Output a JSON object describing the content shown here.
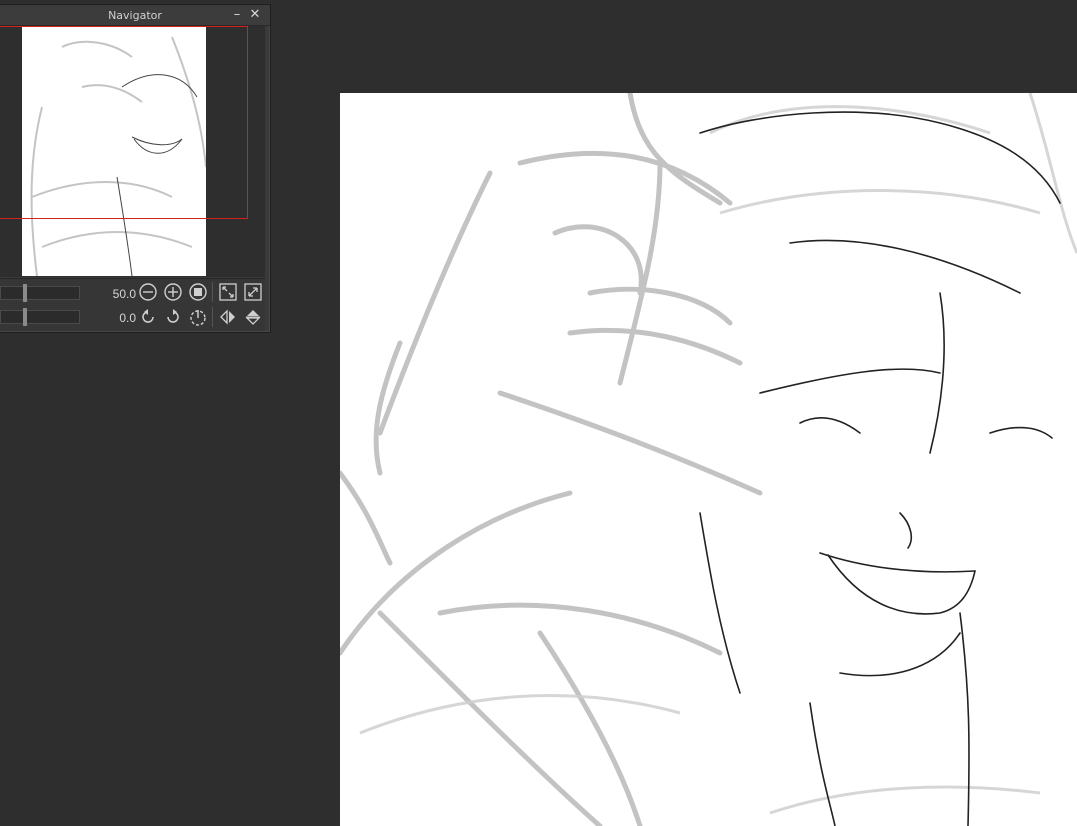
{
  "navigator": {
    "title": "Navigator",
    "minimize_icon": "minimize-icon",
    "close_icon": "close-icon",
    "zoom_value": "50.0",
    "rotate_value": "0.0",
    "controls_row1": [
      "zoom-out-icon",
      "zoom-in-icon",
      "actual-size-icon",
      "fit-window-icon",
      "fill-window-icon"
    ],
    "controls_row2": [
      "rotate-left-icon",
      "rotate-right-icon",
      "reset-rotation-icon",
      "flip-horizontal-icon",
      "flip-vertical-icon"
    ]
  },
  "colors": {
    "workspace_bg": "#2e2e2e",
    "panel_bg": "#3a3a3a",
    "view_frame": "#d62020",
    "canvas_bg": "#ffffff"
  }
}
